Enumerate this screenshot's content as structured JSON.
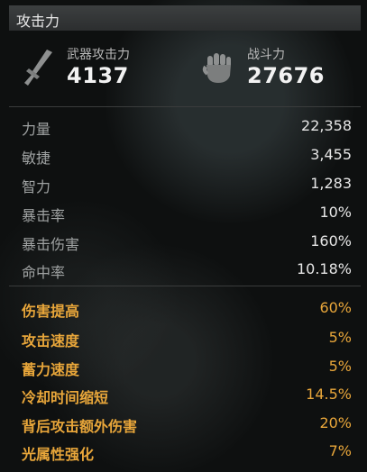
{
  "panel": {
    "title": "攻击力"
  },
  "weapon_attack": {
    "label": "武器攻击力",
    "value": "4137",
    "icon": "sword-icon"
  },
  "combat_power": {
    "label": "战斗力",
    "value": "27676",
    "icon": "fist-icon"
  },
  "base_stats": [
    {
      "label": "力量",
      "value": "22,358"
    },
    {
      "label": "敏捷",
      "value": "3,455"
    },
    {
      "label": "智力",
      "value": "1,283"
    },
    {
      "label": "暴击率",
      "value": "10%"
    },
    {
      "label": "暴击伤害",
      "value": "160%"
    },
    {
      "label": "命中率",
      "value": "10.18%"
    }
  ],
  "bonus_stats": [
    {
      "label": "伤害提高",
      "value": "60%"
    },
    {
      "label": "攻击速度",
      "value": "5%"
    },
    {
      "label": "蓄力速度",
      "value": "5%"
    },
    {
      "label": "冷却时间缩短",
      "value": "14.5%"
    },
    {
      "label": "背后攻击额外伤害",
      "value": "20%"
    },
    {
      "label": "光属性强化",
      "value": "7%"
    }
  ],
  "colors": {
    "accent": "#e8a63a",
    "label": "#9fa2a2",
    "value": "#e6e6e6"
  }
}
